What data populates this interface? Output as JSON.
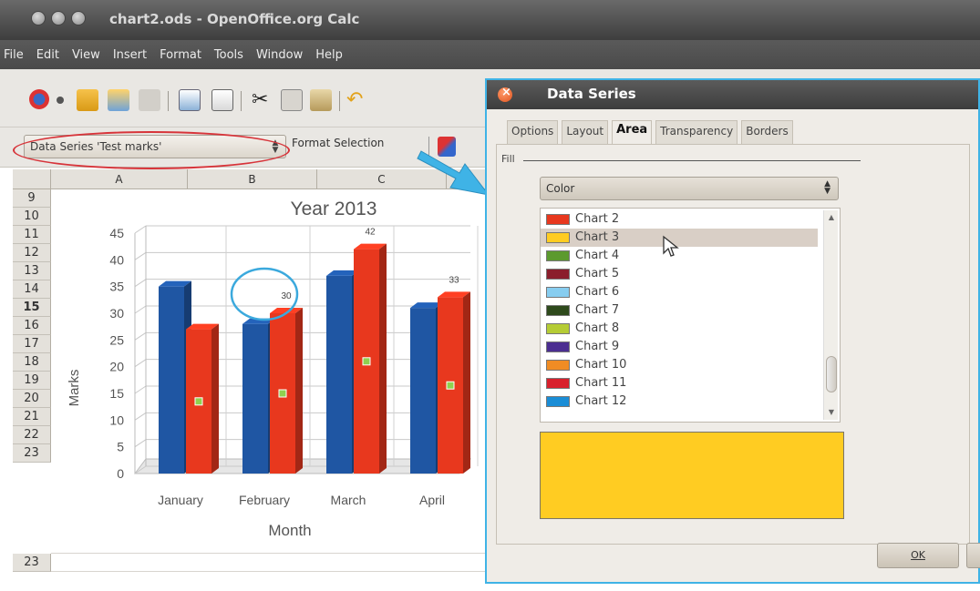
{
  "window": {
    "title": "chart2.ods - OpenOffice.org Calc"
  },
  "menu": [
    "File",
    "Edit",
    "View",
    "Insert",
    "Format",
    "Tools",
    "Window",
    "Help"
  ],
  "toolbar2": {
    "series_selection": "Data Series 'Test marks'",
    "format_selection_label": "Format Selection"
  },
  "sheet": {
    "columns": [
      "A",
      "B",
      "C"
    ],
    "rows": [
      "9",
      "10",
      "11",
      "12",
      "13",
      "14",
      "15",
      "16",
      "17",
      "18",
      "19",
      "20",
      "21",
      "22",
      "23"
    ],
    "active_row": "15"
  },
  "chart_data": {
    "type": "bar",
    "title": "Year 2013",
    "xlabel": "Month",
    "ylabel": "Marks",
    "categories": [
      "January",
      "February",
      "March",
      "April"
    ],
    "series": [
      {
        "values": [
          35,
          28,
          37,
          31
        ],
        "color": "#1f56a3"
      },
      {
        "values": [
          27,
          30,
          42,
          33
        ],
        "color": "#e8381e"
      }
    ],
    "data_labels": [
      "",
      "30",
      "42",
      "33"
    ],
    "yticks": [
      "0",
      "5",
      "10",
      "15",
      "20",
      "25",
      "30",
      "35",
      "40",
      "45"
    ],
    "ylim": [
      0,
      45
    ],
    "grid": true
  },
  "dialog": {
    "title": "Data Series",
    "tabs": [
      "Options",
      "Layout",
      "Area",
      "Transparency",
      "Borders"
    ],
    "active_tab": "Area",
    "fill_label": "Fill",
    "fill_type": "Color",
    "colors": [
      {
        "name": "Chart 2",
        "hex": "#e8381e"
      },
      {
        "name": "Chart 3",
        "hex": "#ffcc22"
      },
      {
        "name": "Chart 4",
        "hex": "#5c9a2e"
      },
      {
        "name": "Chart 5",
        "hex": "#8b1e2c"
      },
      {
        "name": "Chart 6",
        "hex": "#87cdf0"
      },
      {
        "name": "Chart 7",
        "hex": "#2e4a1c"
      },
      {
        "name": "Chart 8",
        "hex": "#b5cc35"
      },
      {
        "name": "Chart 9",
        "hex": "#4b2e91"
      },
      {
        "name": "Chart 10",
        "hex": "#f08c24"
      },
      {
        "name": "Chart 11",
        "hex": "#d8202c"
      },
      {
        "name": "Chart 12",
        "hex": "#1a8dd6"
      }
    ],
    "selected_color": "Chart 3",
    "preview_color": "#ffcc22",
    "ok_label": "OK"
  }
}
